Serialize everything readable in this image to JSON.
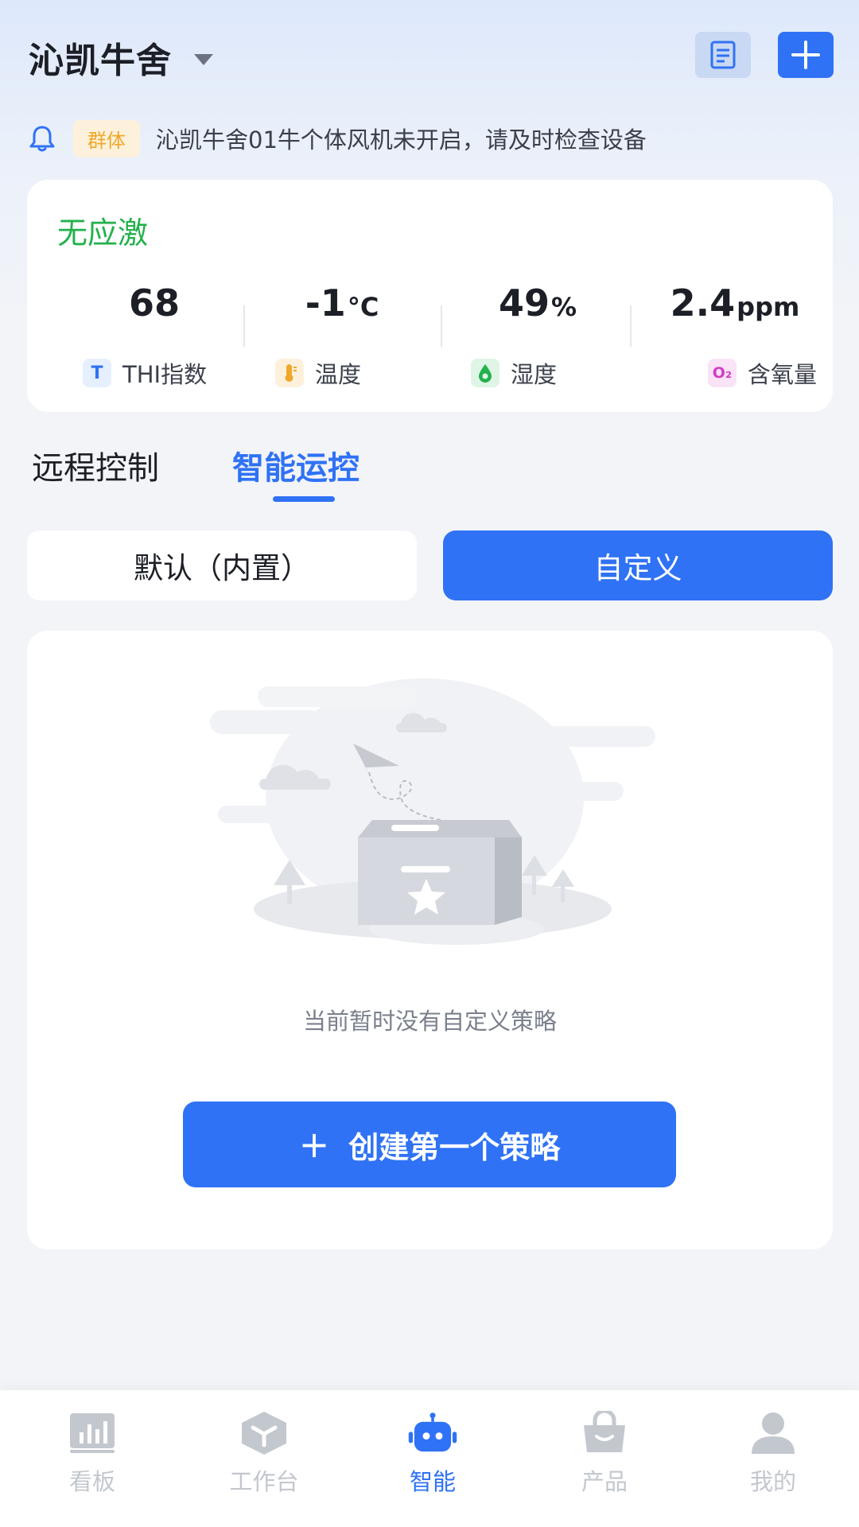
{
  "header": {
    "title": "沁凯牛舍",
    "dropdown_icon": "chevron-down-icon",
    "doc_icon": "document-icon",
    "add_icon": "plus-icon"
  },
  "notice": {
    "icon": "bell-icon",
    "badge": "群体",
    "text": "沁凯牛舍01牛个体风机未开启，请及时检查设备"
  },
  "stats": {
    "status": "无应激",
    "items": [
      {
        "value": "68",
        "unit": "",
        "label": "THI指数",
        "icon": "T"
      },
      {
        "value": "-1",
        "unit": "°C",
        "label": "温度",
        "icon": "thermometer-icon"
      },
      {
        "value": "49",
        "unit": "%",
        "label": "湿度",
        "icon": "droplet-icon"
      },
      {
        "value": "2.4",
        "unit": "ppm",
        "label": "含氧量",
        "icon": "O₂"
      }
    ]
  },
  "tabs": {
    "remote": "远程控制",
    "smart": "智能运控",
    "active": "smart"
  },
  "segments": {
    "default": "默认（内置）",
    "custom": "自定义",
    "active": "custom"
  },
  "empty": {
    "illustration": "empty-box-illustration",
    "text": "当前暂时没有自定义策略",
    "button_icon": "+",
    "button": "创建第一个策略"
  },
  "bottom_nav": {
    "items": [
      {
        "label": "看板",
        "icon": "dashboard-icon"
      },
      {
        "label": "工作台",
        "icon": "workbench-icon"
      },
      {
        "label": "智能",
        "icon": "robot-icon"
      },
      {
        "label": "产品",
        "icon": "shopping-bag-icon"
      },
      {
        "label": "我的",
        "icon": "user-icon"
      }
    ],
    "active": "智能"
  },
  "colors": {
    "primary": "#2f72f5",
    "status_ok": "#22b14c",
    "badge_bg": "#fdf1dc",
    "badge_text": "#f0a82a"
  }
}
